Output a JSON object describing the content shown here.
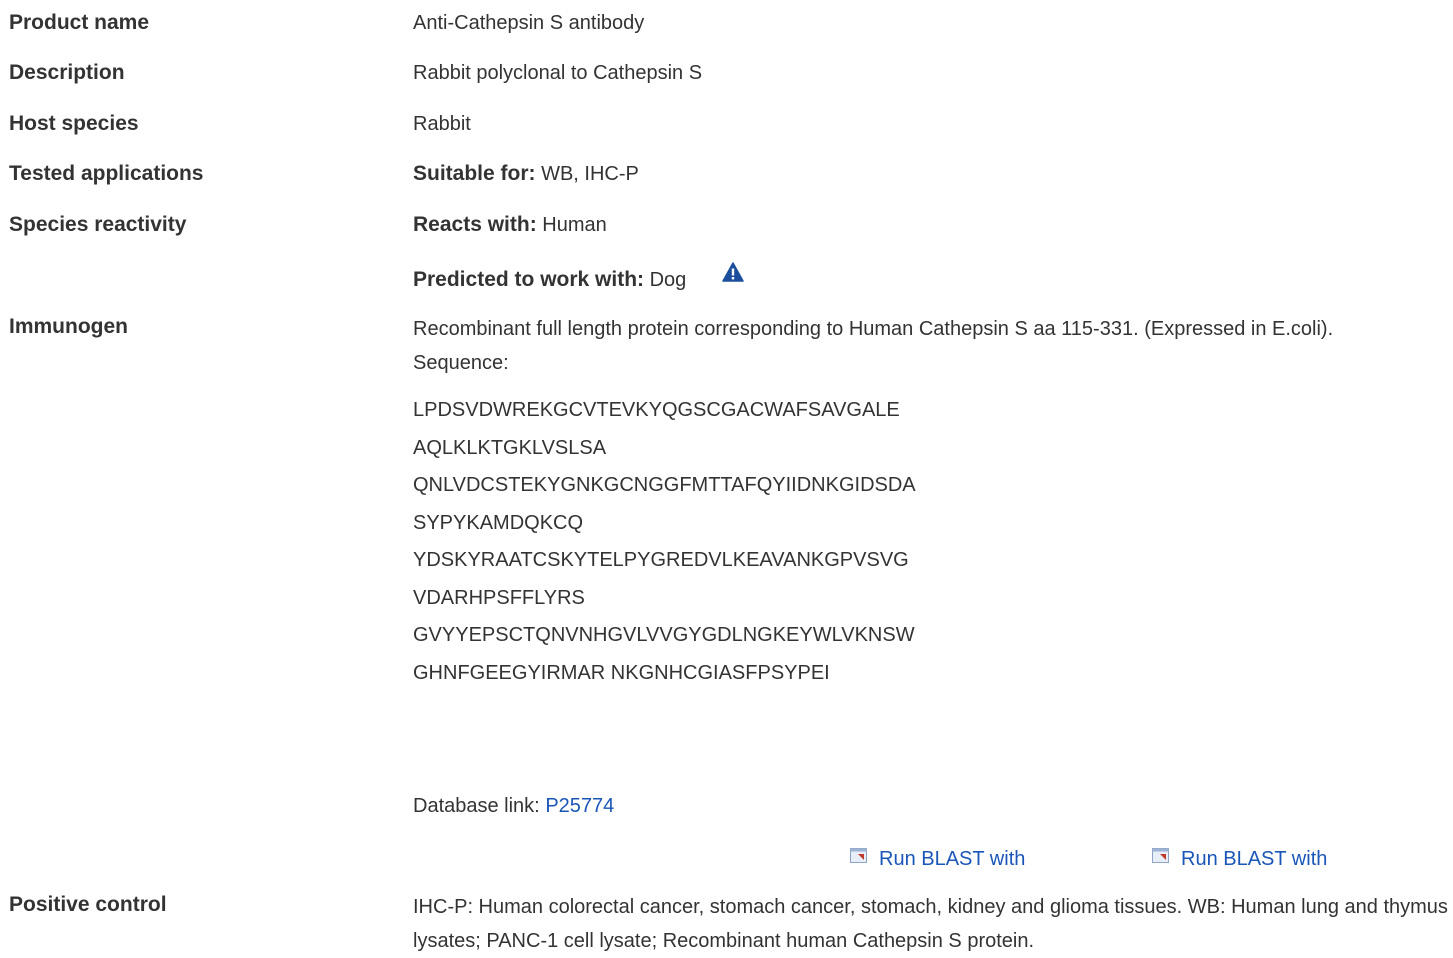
{
  "rows": {
    "product_name": {
      "label": "Product name",
      "value": "Anti-Cathepsin S antibody"
    },
    "description": {
      "label": "Description",
      "value": "Rabbit polyclonal to Cathepsin S"
    },
    "host_species": {
      "label": "Host species",
      "value": "Rabbit"
    },
    "tested_applications": {
      "label": "Tested applications",
      "prefix": "Suitable for:",
      "value": "WB, IHC-P"
    },
    "species_reactivity": {
      "label": "Species reactivity",
      "reacts_prefix": "Reacts with:",
      "reacts_value": "Human",
      "predicted_prefix": "Predicted to work with:",
      "predicted_value": "Dog",
      "warning_icon": "warning-triangle-icon"
    },
    "immunogen": {
      "label": "Immunogen",
      "description": "Recombinant full length protein corresponding to Human Cathepsin S aa 115-331. (Expressed in E.coli).",
      "sequence_label": "Sequence:",
      "sequence_lines": [
        "LPDSVDWREKGCVTEVKYQGSCGACWAFSAVGALE",
        "AQLKLKTGKLVSLSA",
        "QNLVDCSTEKYGNKGCNGGFMTTAFQYIIDNKGIDSDA",
        "SYPYKAMDQKCQ",
        "YDSKYRAATCSKYTELPYGREDVLKEAVANKGPVSVG",
        "VDARHPSFFLYRS",
        "GVYYEPSCTQNVNHGVLVVGYGDLNGKEYWLVKNSW",
        "GHNFGEEGYIRMAR NKGNHCGIASFPSYPEI"
      ],
      "database_link_label": "Database link:",
      "database_link_id": "P25774",
      "blast_links": [
        "Run BLAST with",
        "Run BLAST with"
      ],
      "blast_icon": "external-window-icon"
    },
    "positive_control": {
      "label": "Positive control",
      "value": "IHC-P: Human colorectal cancer, stomach cancer, stomach, kidney and glioma tissues. WB: Human lung and thymus lysates; PANC-1 cell lysate; Recombinant human Cathepsin S protein."
    }
  },
  "colors": {
    "text": "#333333",
    "link": "#1a56b8",
    "warning_icon": "#1b4f9c"
  }
}
